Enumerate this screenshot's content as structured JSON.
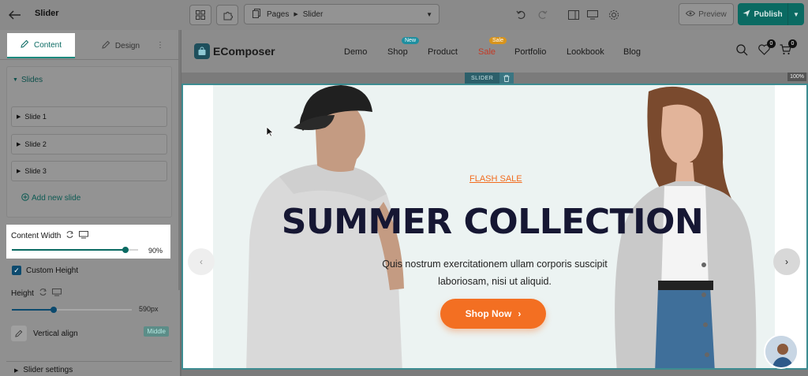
{
  "topbar": {
    "title": "Slider",
    "breadcrumb": {
      "root": "Pages",
      "current": "Slider"
    },
    "preview_label": "Preview",
    "publish_label": "Publish"
  },
  "panel": {
    "tabs": {
      "content": "Content",
      "design": "Design"
    },
    "slides_section": "Slides",
    "slides": [
      "Slide 1",
      "Slide 2",
      "Slide 3"
    ],
    "add_slide": "Add new slide",
    "content_width": {
      "label": "Content Width",
      "value": "90%",
      "fraction": 0.9
    },
    "custom_height": {
      "label": "Custom Height",
      "checked": true
    },
    "height": {
      "label": "Height",
      "value": "590px",
      "fraction": 0.35
    },
    "vertical_align": {
      "label": "Vertical align",
      "value": "Middle"
    },
    "slider_settings": "Slider settings"
  },
  "site": {
    "logo": "EComposer",
    "nav": [
      {
        "label": "Demo"
      },
      {
        "label": "Shop",
        "badge": "New",
        "badge_color": "#1f8fa0"
      },
      {
        "label": "Product"
      },
      {
        "label": "Sale",
        "badge": "Sale",
        "badge_color": "#d8941c",
        "color": "#c43a25"
      },
      {
        "label": "Portfolio"
      },
      {
        "label": "Lookbook"
      },
      {
        "label": "Blog"
      }
    ],
    "wishlist_count": "0",
    "cart_count": "0"
  },
  "canvas": {
    "element_tag": "SLIDER",
    "zoom": "100%"
  },
  "hero": {
    "eyebrow": "FLASH SALE",
    "title": "SUMMER COLLECTION",
    "description": "Quis nostrum exercitationem ullam corporis suscipit laboriosam, nisi ut aliquid.",
    "cta": "Shop Now"
  },
  "colors": {
    "accent": "#0a6a62",
    "cta": "#f36f22",
    "title": "#161733"
  }
}
